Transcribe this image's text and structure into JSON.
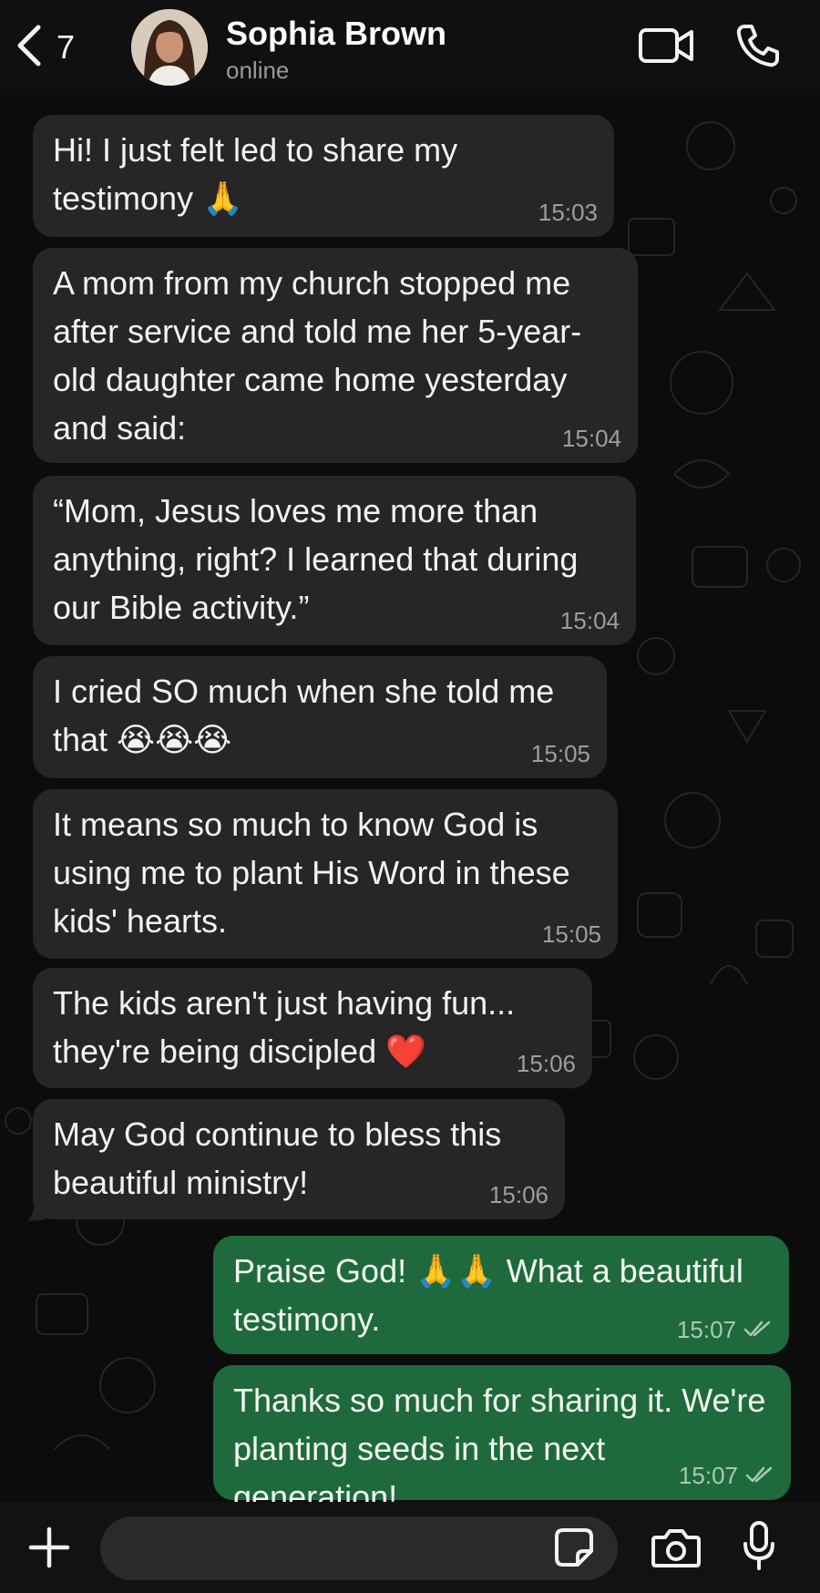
{
  "header": {
    "back_count": "7",
    "contact_name": "Sophia Brown",
    "status": "online"
  },
  "messages": [
    {
      "direction": "in",
      "text": "Hi! I just felt led to share my\ntestimony 🙏",
      "time": "15:03"
    },
    {
      "direction": "in",
      "text": "A mom from my church stopped me\nafter service and told me her 5-year-\nold daughter came home yesterday\nand said:",
      "time": "15:04"
    },
    {
      "direction": "in",
      "text": "“Mom, Jesus loves me more than\nanything, right? I learned that during\nour Bible activity.”",
      "time": "15:04"
    },
    {
      "direction": "in",
      "text": "I cried SO much when she told me\nthat 😭😭😭",
      "time": "15:05"
    },
    {
      "direction": "in",
      "text": "It means so much to know God is\nusing me to plant His Word in these\nkids' hearts.",
      "time": "15:05"
    },
    {
      "direction": "in",
      "text": "The kids aren't just having fun...\nthey're being discipled ❤️",
      "time": "15:06"
    },
    {
      "direction": "in",
      "text": "May God continue to bless this\nbeautiful ministry!",
      "time": "15:06"
    },
    {
      "direction": "out",
      "text": "Praise God! 🙏🙏 What a beautiful\ntestimony.",
      "time": "15:07"
    },
    {
      "direction": "out",
      "text": "Thanks so much for sharing it. We're\nplanting seeds in the next generation!",
      "time": "15:07"
    }
  ],
  "input": {
    "placeholder": ""
  },
  "icons": {
    "back": "chevron-left-icon",
    "video": "video-camera-icon",
    "call": "phone-icon",
    "attach": "plus-icon",
    "sticker": "sticker-icon",
    "camera": "camera-icon",
    "mic": "microphone-icon",
    "read_receipt": "double-check-icon"
  },
  "colors": {
    "incoming_bubble": "#262626",
    "outgoing_bubble": "#1f6a3c",
    "background": "#0c0c0c"
  }
}
